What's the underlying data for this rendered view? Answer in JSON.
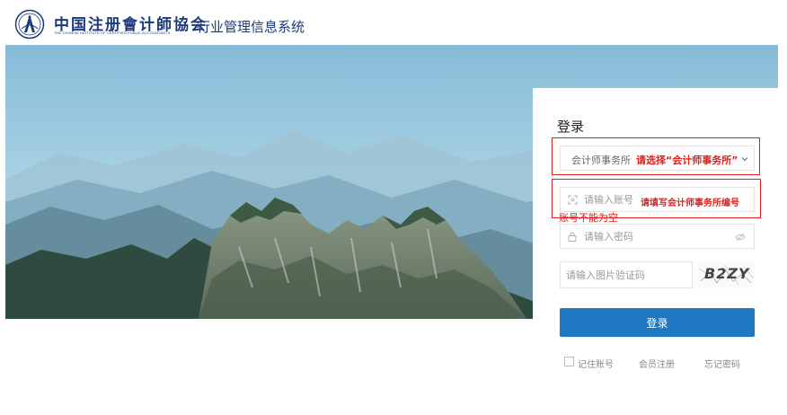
{
  "header": {
    "org_name_cn": "中国注册會计師協会",
    "org_name_en": "THE CHINESE INSTITUTE OF CERTIFIED PUBLIC ACCOUNTANTS",
    "system_name": "行业管理信息系统"
  },
  "login": {
    "title": "登录",
    "org_select": {
      "value": "会计师事务所",
      "hint": "请选择“会计师事务所”"
    },
    "account": {
      "placeholder": "请输入账号",
      "hint": "请填写会计师事务所编号",
      "error": "账号不能为空"
    },
    "password": {
      "placeholder": "请输入密码"
    },
    "captcha": {
      "placeholder": "请输入图片验证码",
      "image_text": "B2ZY"
    },
    "submit_label": "登录",
    "remember_label": "记住账号",
    "register_label": "会员注册",
    "forgot_label": "忘记密码"
  },
  "colors": {
    "brand": "#1b3a7a",
    "primary_button": "#1f78c1",
    "error": "#e02020"
  },
  "icons": [
    "emblem-icon",
    "chevron-down-icon",
    "scan-icon",
    "lock-icon",
    "eye-off-icon"
  ]
}
